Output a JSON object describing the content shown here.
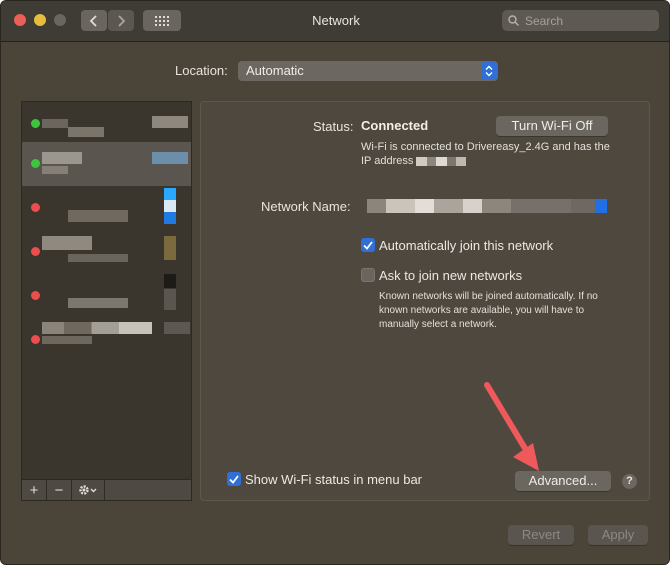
{
  "window": {
    "title": "Network"
  },
  "toolbar": {
    "back_icon": "chevron-left-icon",
    "forward_icon": "chevron-right-icon",
    "grid_icon": "grid-icon"
  },
  "search": {
    "placeholder": "Search"
  },
  "location": {
    "label": "Location:",
    "value": "Automatic"
  },
  "sidebar": {
    "services": [
      {
        "status": "green",
        "selected": false
      },
      {
        "status": "green",
        "selected": true
      },
      {
        "status": "red",
        "selected": false
      },
      {
        "status": "red",
        "selected": false
      },
      {
        "status": "red",
        "selected": false
      },
      {
        "status": "red",
        "selected": false
      }
    ],
    "add_label": "+",
    "remove_label": "−",
    "action_icon": "gear-icon"
  },
  "panel": {
    "status_label": "Status:",
    "status_value": "Connected",
    "turn_off_label": "Turn Wi-Fi Off",
    "status_desc_part1": "Wi-Fi is connected to Drivereasy_2.4G and has the IP address",
    "network_name_label": "Network Name:",
    "auto_join_label": "Automatically join this network",
    "auto_join_checked": true,
    "ask_join_label": "Ask to join new networks",
    "ask_join_checked": false,
    "ask_join_help": "Known networks will be joined automatically. If no known networks are available, you will have to manually select a network.",
    "show_status_label": "Show Wi-Fi status in menu bar",
    "show_status_checked": true,
    "advanced_label": "Advanced...",
    "help_label": "?"
  },
  "footer": {
    "revert_label": "Revert",
    "apply_label": "Apply"
  },
  "colors": {
    "accent": "#2f6fd6",
    "annotation_arrow": "#f0595b",
    "status_green": "#3ec53e",
    "status_red": "#ee4d4d"
  }
}
